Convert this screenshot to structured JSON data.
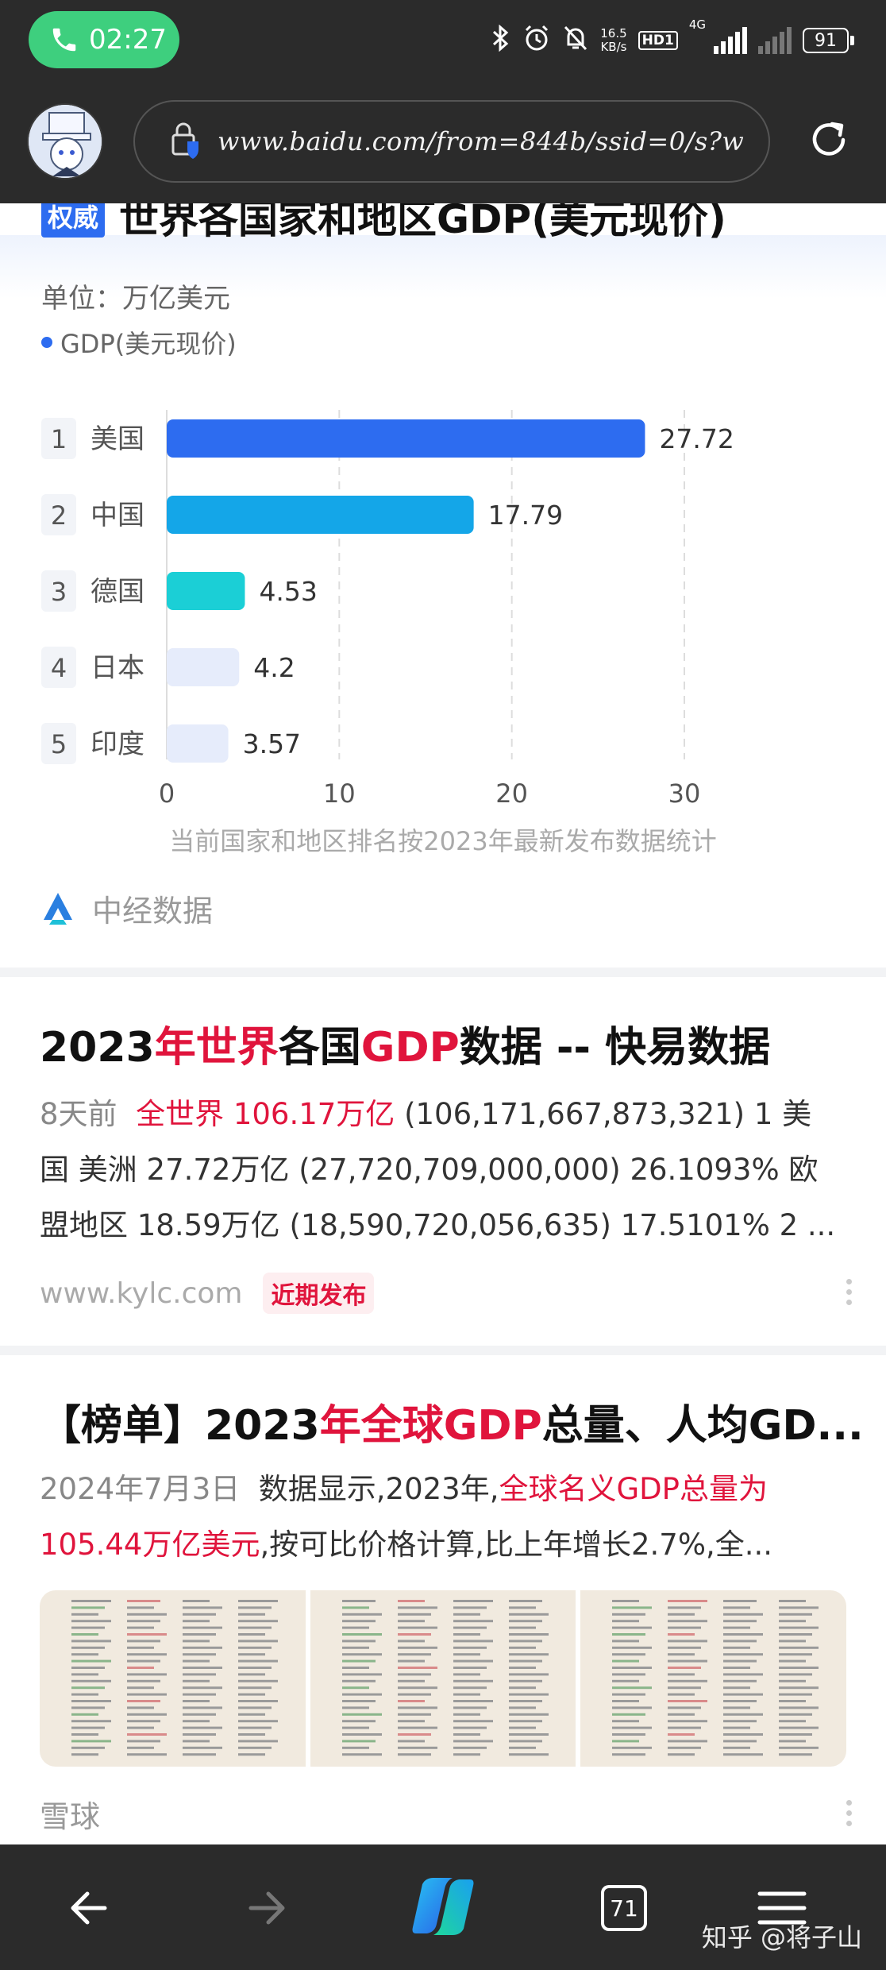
{
  "status_bar": {
    "call_time": "02:27",
    "net_speed_value": "16.5",
    "net_speed_unit": "KB/s",
    "hd_badge": "HD1",
    "network_type": "4G",
    "battery": "91"
  },
  "browser": {
    "url": "www.baidu.com/from=844b/ssid=0/s?w",
    "tab_count": "71"
  },
  "gdp_card": {
    "badge": "权威",
    "title": "世界各国家和地区GDP(美元现价)",
    "unit_label": "单位：万亿美元",
    "legend_label": "GDP(美元现价)",
    "note": "当前国家和地区排名按2023年最新发布数据统计",
    "source": "中经数据"
  },
  "chart_data": {
    "type": "bar",
    "orientation": "horizontal",
    "categories": [
      "美国",
      "中国",
      "德国",
      "日本",
      "印度"
    ],
    "ranks": [
      "1",
      "2",
      "3",
      "4",
      "5"
    ],
    "values": [
      27.72,
      17.79,
      4.53,
      4.2,
      3.57
    ],
    "value_labels": [
      "27.72",
      "17.79",
      "4.53",
      "4.2",
      "3.57"
    ],
    "bar_colors": [
      "#2d6cf0",
      "#14a6e8",
      "#1bcfd6",
      "#e6ecfb",
      "#e6ecfb"
    ],
    "x_ticks": [
      "0",
      "10",
      "20",
      "30"
    ],
    "xlim": [
      0,
      30
    ],
    "grid": true,
    "series": [
      {
        "name": "GDP(美元现价)",
        "values": [
          27.72,
          17.79,
          4.53,
          4.2,
          3.57
        ]
      }
    ]
  },
  "result1": {
    "title_parts": [
      {
        "text": "2023",
        "hl": false
      },
      {
        "text": "年世界",
        "hl": true
      },
      {
        "text": "各国",
        "hl": false
      },
      {
        "text": "GDP",
        "hl": true
      },
      {
        "text": "数据 -- 快易数据",
        "hl": false
      }
    ],
    "date": "8天前",
    "snippet_highlight": "全世界 106.17万亿",
    "snippet_line1": " (106,171,667,873,321) 1 美",
    "snippet_line2": "国 美洲 27.72万亿 (27,720,709,000,000) 26.1093% 欧",
    "snippet_line3": "盟地区 18.59万亿 (18,590,720,056,635) 17.5101% 2 ...",
    "site": "www.kylc.com",
    "tag": "近期发布"
  },
  "result2": {
    "title_parts": [
      {
        "text": "【榜单】2023",
        "hl": false
      },
      {
        "text": "年全球GDP",
        "hl": true
      },
      {
        "text": "总量、人均GD...",
        "hl": false
      }
    ],
    "date": "2024年7月3日",
    "snippet_pre": "数据显示,2023年,",
    "snippet_hl1": "全球名义GDP总量为",
    "snippet_hl2": "105.44万亿美元",
    "snippet_post": ",按可比价格计算,比上年增长2.7%,全...",
    "site": "雪球"
  },
  "watermark": "知乎 @将子山"
}
